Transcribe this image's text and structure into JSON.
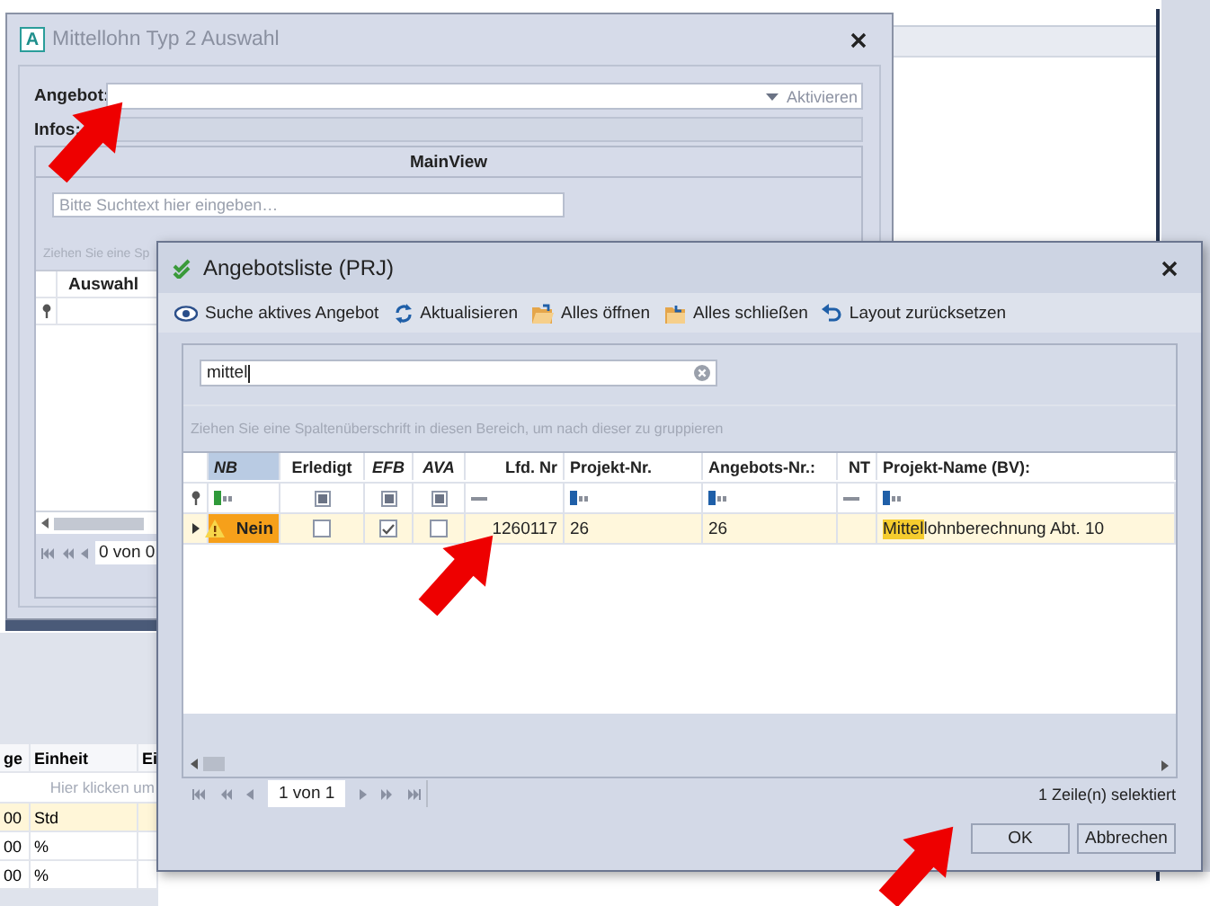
{
  "background_app": {
    "grid": {
      "columns": [
        "ge",
        "Einheit",
        "Ei"
      ],
      "hint": "Hier klicken um",
      "rows": [
        {
          "selected": true,
          "cells": [
            "00",
            "Std"
          ]
        },
        {
          "selected": false,
          "cells": [
            "00",
            "%"
          ]
        },
        {
          "selected": false,
          "cells": [
            "00",
            "%"
          ]
        }
      ]
    }
  },
  "selection_dialog": {
    "icon_letter": "A",
    "title": "Mittellohn Typ 2 Auswahl",
    "active": false,
    "fields": [
      {
        "kind": "combo",
        "label": "Angebot:",
        "button": "Aktivieren"
      },
      {
        "kind": "display",
        "label": "Infos:"
      }
    ],
    "main_view": {
      "title": "MainView",
      "search": {
        "placeholder": "Bitte Suchtext hier eingeben…"
      },
      "group_hint": "Ziehen Sie eine Sp",
      "columns": [
        "Auswahl"
      ],
      "pager": "0 von 0"
    }
  },
  "list_dialog": {
    "title": "Angebotsliste (PRJ)",
    "active": true,
    "toolbar": [
      {
        "kind": "search",
        "label": "Suche aktives Angebot"
      },
      {
        "kind": "refresh",
        "label": "Aktualisieren"
      },
      {
        "kind": "expand",
        "label": "Alles öffnen"
      },
      {
        "kind": "collapse",
        "label": "Alles schließen"
      },
      {
        "kind": "reset",
        "label": "Layout zurücksetzen"
      }
    ],
    "search": {
      "value": "mittel"
    },
    "group_hint": "Ziehen Sie eine Spaltenüberschrift in diesen Bereich, um nach dieser zu gruppieren",
    "columns": [
      {
        "title": "NB",
        "italic": true,
        "selected": true,
        "kind": "status"
      },
      {
        "title": "Erledigt",
        "italic": false,
        "selected": false,
        "kind": "check"
      },
      {
        "title": "EFB",
        "italic": true,
        "selected": false,
        "kind": "check"
      },
      {
        "title": "AVA",
        "italic": true,
        "selected": false,
        "kind": "check"
      },
      {
        "title": "Lfd. Nr",
        "italic": false,
        "selected": false,
        "kind": "number"
      },
      {
        "title": "Projekt-Nr.",
        "italic": false,
        "selected": false,
        "kind": "text"
      },
      {
        "title": "Angebots-Nr.:",
        "italic": false,
        "selected": false,
        "kind": "text"
      },
      {
        "title": "NT",
        "italic": false,
        "selected": false,
        "kind": "flag"
      },
      {
        "title": "Projekt-Name (BV):",
        "italic": false,
        "selected": false,
        "kind": "text"
      }
    ],
    "rows": [
      {
        "selected": true,
        "cells": [
          {
            "kind": "status",
            "text": "Nein"
          },
          {
            "kind": "check",
            "checked": false
          },
          {
            "kind": "check",
            "checked": true
          },
          {
            "kind": "check",
            "checked": false
          },
          {
            "kind": "text",
            "text": "1260117"
          },
          {
            "kind": "text",
            "text": "26"
          },
          {
            "kind": "text",
            "text": "26"
          },
          {
            "kind": "empty"
          },
          {
            "kind": "match",
            "parts": [
              {
                "text": "Mittel",
                "highlighted": true
              },
              {
                "text": "lohnberechnung Abt. 10",
                "highlighted": false
              }
            ]
          }
        ]
      }
    ],
    "pager": "1 von 1",
    "status": "1 Zeile(n) selektiert",
    "buttons": [
      "OK",
      "Abbrechen"
    ]
  }
}
